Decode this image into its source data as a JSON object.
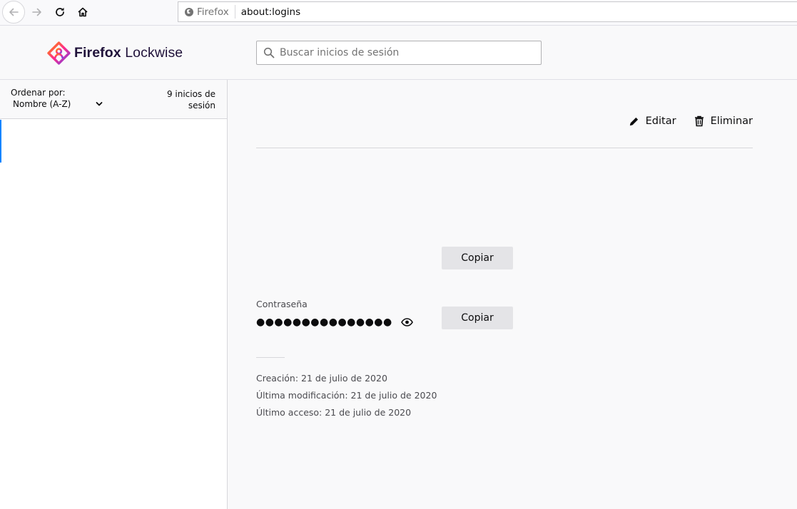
{
  "browser": {
    "identity_label": "Firefox",
    "url": "about:logins"
  },
  "header": {
    "brand_bold": "Firefox",
    "brand_rest": " Lockwise",
    "search_placeholder": "Buscar inicios de sesión"
  },
  "sidebar": {
    "sort_label": "Ordenar por:",
    "sort_value": "Nombre (A-Z)",
    "count_text": "9 inicios de sesión"
  },
  "detail": {
    "edit_label": "Editar",
    "delete_label": "Eliminar",
    "copy_label": "Copiar",
    "password_label": "Contraseña",
    "password_masked": "●●●●●●●●●●●●●●●",
    "created": "Creación: 21 de julio de 2020",
    "modified": "Última modificación: 21 de julio de 2020",
    "last_used": "Último acceso: 21 de julio de 2020"
  },
  "icons": [
    "back-arrow-icon",
    "forward-arrow-icon",
    "reload-icon",
    "home-icon",
    "firefox-identity-icon",
    "lockwise-logo-icon",
    "search-icon",
    "chevron-down-icon",
    "pencil-icon",
    "trash-icon",
    "eye-icon"
  ],
  "colors": {
    "accent": "#0a84ff",
    "brand_text": "#20123a",
    "button_bg": "#e4e4e7"
  }
}
